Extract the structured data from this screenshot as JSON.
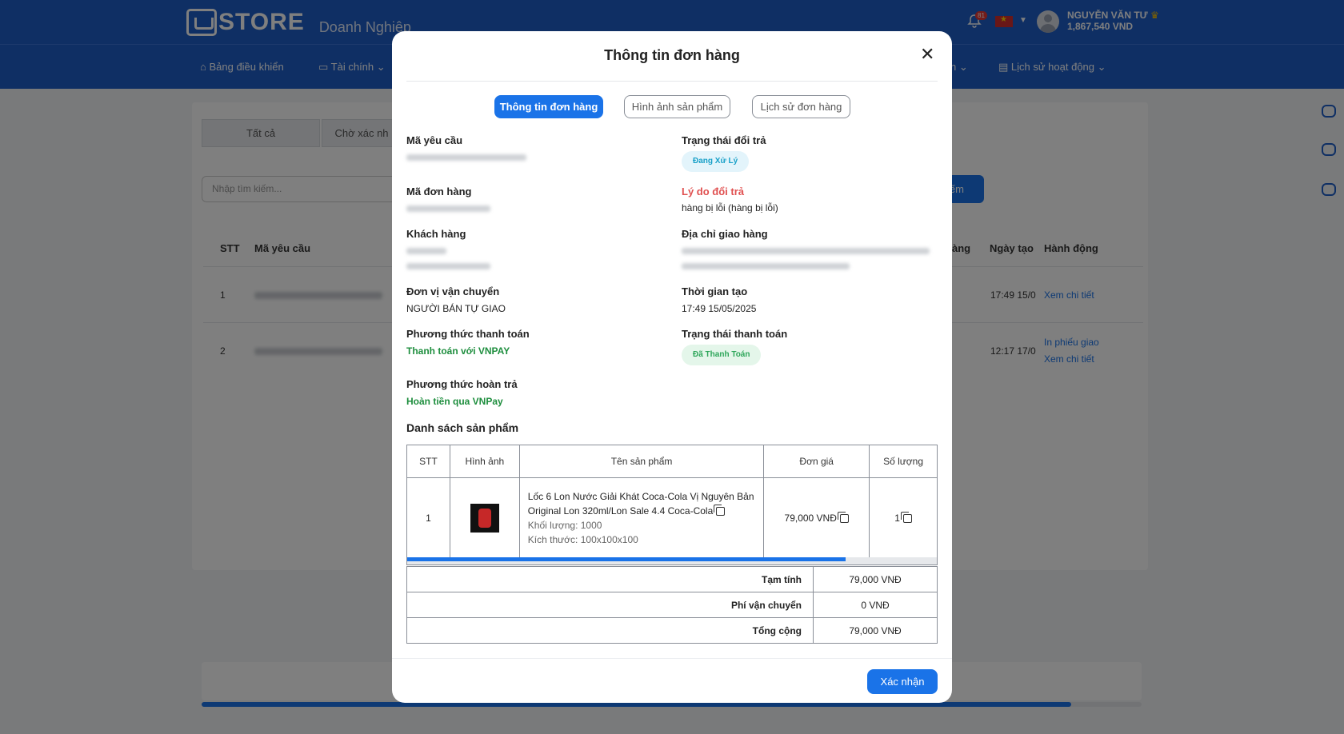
{
  "header": {
    "logo_text": "STORE",
    "logo_sub": "Doanh Nghiệp",
    "notif_count": "81",
    "user_name": "NGUYỄN VĂN TƯ",
    "user_balance": "1,867,540 VND"
  },
  "nav": {
    "dashboard": "Bảng điều khiển",
    "finance": "Tài chính",
    "partial_item": "n",
    "activity": "Lịch sử hoạt động"
  },
  "background": {
    "tab_all": "Tất cả",
    "tab_pending": "Chờ xác nh",
    "search_placeholder": "Nhập tìm kiếm...",
    "search_btn": "iếm",
    "col_stt": "STT",
    "col_code": "Mã yêu cầu",
    "col_partial": "àng",
    "col_created": "Ngày tạo",
    "col_action": "Hành động",
    "rows": [
      {
        "stt": "1",
        "created": "17:49 15/0",
        "action1": "Xem chi tiết"
      },
      {
        "stt": "2",
        "created": "12:17 17/0",
        "action1": "In phiếu giao",
        "action2": "Xem chi tiết"
      }
    ]
  },
  "modal": {
    "title": "Thông tin đơn hàng",
    "tabs": [
      "Thông tin đơn hàng",
      "Hình ảnh sản phẩm",
      "Lịch sử đơn hàng"
    ],
    "request_code_label": "Mã yêu cầu",
    "return_status_label": "Trạng thái đổi trả",
    "return_status_value": "Đang Xử Lý",
    "order_code_label": "Mã đơn hàng",
    "return_reason_label": "Lý do đổi trả",
    "return_reason_value": "hàng bị lỗi (hàng bị lỗi)",
    "customer_label": "Khách hàng",
    "address_label": "Địa chỉ giao hàng",
    "carrier_label": "Đơn vị vận chuyển",
    "carrier_value": "NGƯỜI BÁN TỰ GIAO",
    "created_label": "Thời gian tạo",
    "created_value": "17:49 15/05/2025",
    "payment_method_label": "Phương thức thanh toán",
    "payment_method_value": "Thanh toán với VNPAY",
    "payment_status_label": "Trạng thái thanh toán",
    "payment_status_value": "Đã Thanh Toán",
    "refund_method_label": "Phương thức hoàn trả",
    "refund_method_value": "Hoàn tiền qua VNPay",
    "products_title": "Danh sách sản phẩm",
    "table_headers": [
      "STT",
      "Hình ảnh",
      "Tên sản phẩm",
      "Đơn giá",
      "Số lượng"
    ],
    "products": [
      {
        "stt": "1",
        "name": "Lốc 6 Lon Nước Giải Khát Coca-Cola Vị Nguyên Bản Original Lon 320ml/Lon Sale 4.4 Coca-Cola",
        "weight": "Khối lượng: 1000",
        "size": "Kích thước: 100x100x100",
        "price": "79,000 VNĐ",
        "qty": "1"
      }
    ],
    "subtotal_label": "Tạm tính",
    "subtotal_value": "79,000 VNĐ",
    "shipping_label": "Phí vận chuyển",
    "shipping_value": "0 VNĐ",
    "total_label": "Tổng cộng",
    "total_value": "79,000 VNĐ",
    "confirm_btn": "Xác nhận"
  }
}
